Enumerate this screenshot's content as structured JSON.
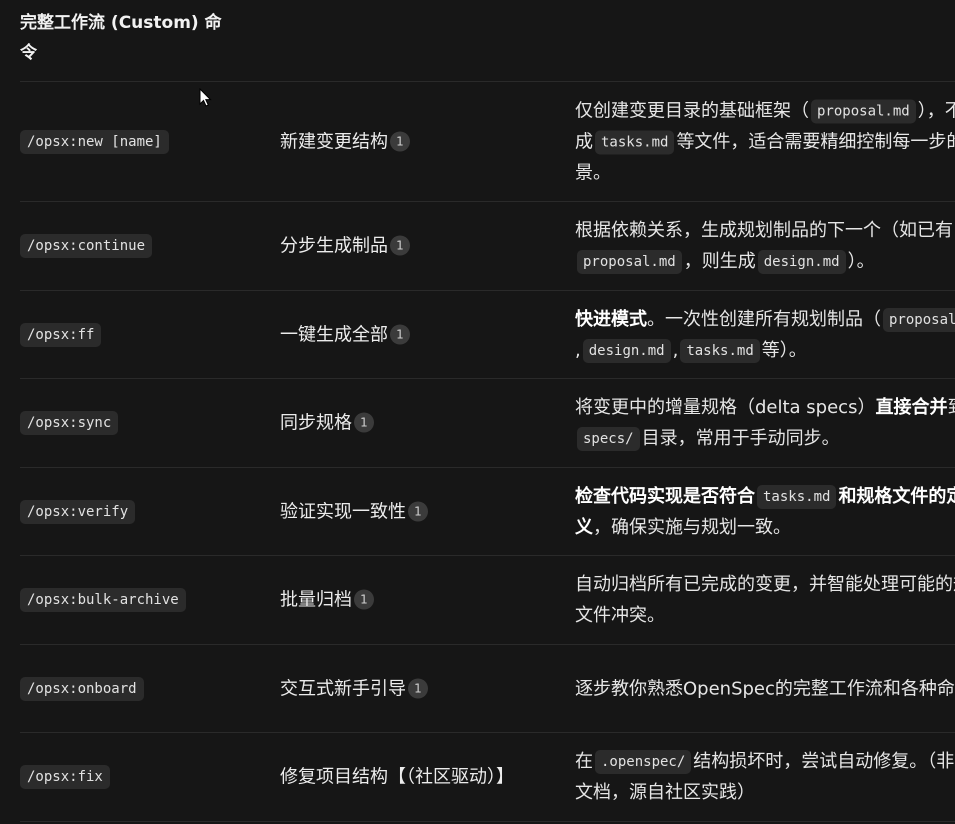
{
  "table": {
    "header": "完整工作流 (Custom) 命令",
    "rows": [
      {
        "command": "/opsx:new [name]",
        "name": "新建变更结构",
        "badge": "1",
        "desc": {
          "t1": "仅创建变更目录的基础框架（",
          "c1": "proposal.md",
          "t2": "），不生成",
          "c2": "tasks.md",
          "t3": "等文件，适合需要精细控制每一步的场景。"
        }
      },
      {
        "command": "/opsx:continue",
        "name": "分步生成制品",
        "badge": "1",
        "desc": {
          "t1": "根据依赖关系，生成规划制品的下一个（如已有",
          "c1": "proposal.md",
          "t2": "，则生成",
          "c2": "design.md",
          "t3": "）。"
        }
      },
      {
        "command": "/opsx:ff",
        "name": "一键生成全部",
        "badge": "1",
        "desc": {
          "b1": "快进模式",
          "t1": "。一次性创建所有规划制品（",
          "c1": "proposal.md",
          "s1": ",",
          "c2": "design.md",
          "s2": ",",
          "c3": "tasks.md",
          "t2": "等）。"
        }
      },
      {
        "command": "/opsx:sync",
        "name": "同步规格",
        "badge": "1",
        "desc": {
          "t1": "将变更中的增量规格（delta specs）",
          "b1": "直接合并",
          "t2": "到主",
          "c1": "specs/",
          "t3": "目录，常用于手动同步。"
        }
      },
      {
        "command": "/opsx:verify",
        "name": "验证实现一致性",
        "badge": "1",
        "desc": {
          "b1": "检查代码实现是否符合",
          "c1": "tasks.md",
          "b2": "和规格文件的定义",
          "t1": "，确保实施与规划一致。"
        }
      },
      {
        "command": "/opsx:bulk-archive",
        "name": "批量归档",
        "badge": "1",
        "desc": {
          "t1": "自动归档所有已完成的变更，并智能处理可能的规格文件冲突。"
        }
      },
      {
        "command": "/opsx:onboard",
        "name": "交互式新手引导",
        "badge": "1",
        "desc": {
          "t1": "逐步教你熟悉OpenSpec的完整工作流和各种命令。"
        }
      },
      {
        "command": "/opsx:fix",
        "name": "修复项目结构【（社区驱动）】",
        "desc": {
          "t1": "在",
          "c1": ".openspec/",
          "t2": "结构损坏时，尝试自动修复。（非官方文档，源自社区实践）"
        }
      }
    ]
  }
}
